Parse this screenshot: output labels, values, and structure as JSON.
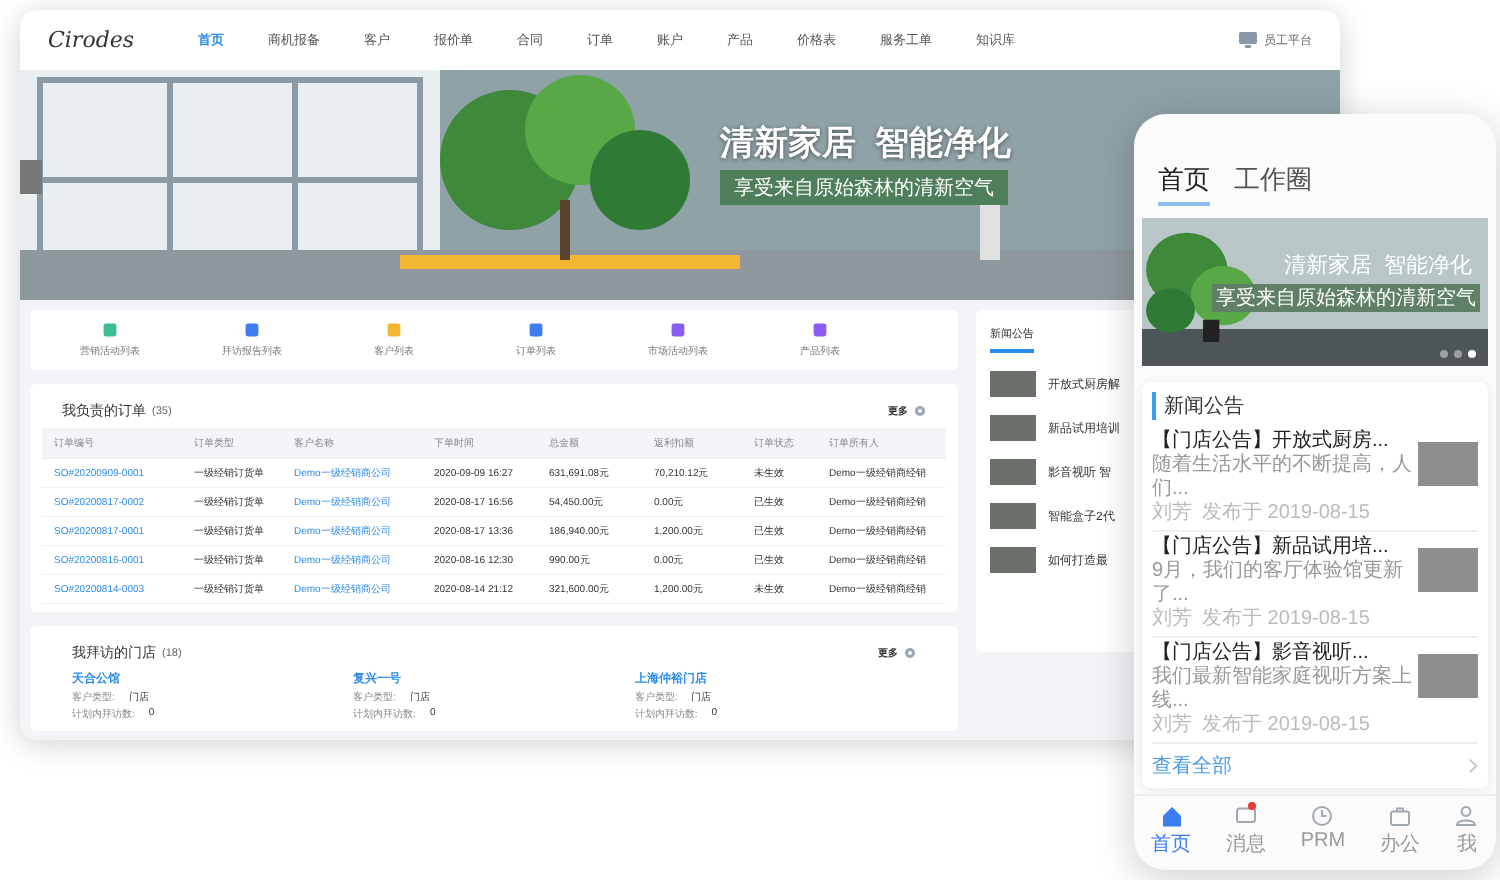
{
  "desktop": {
    "logo": "Cirodes",
    "nav": [
      {
        "label": "首页",
        "selected": true
      },
      {
        "label": "商机报备",
        "selected": false
      },
      {
        "label": "客户",
        "selected": false
      },
      {
        "label": "报价单",
        "selected": false
      },
      {
        "label": "合同",
        "selected": false
      },
      {
        "label": "订单",
        "selected": false
      },
      {
        "label": "账户",
        "selected": false
      },
      {
        "label": "产品",
        "selected": false
      },
      {
        "label": "价格表",
        "selected": false
      },
      {
        "label": "服务工单",
        "selected": false
      },
      {
        "label": "知识库",
        "selected": false
      }
    ],
    "portal": "员工平台",
    "banner": {
      "headline": "清新家居  智能净化",
      "tagline": "享受来自原始森林的清新空气"
    },
    "quick_links": [
      {
        "label": "营销活动列表",
        "color": "#3bbf8f"
      },
      {
        "label": "拜访报告列表",
        "color": "#3b7cf0"
      },
      {
        "label": "客户列表",
        "color": "#f2b632"
      },
      {
        "label": "订单列表",
        "color": "#3b7cf0"
      },
      {
        "label": "市场活动列表",
        "color": "#8a5cf0"
      },
      {
        "label": "产品列表",
        "color": "#8a5cf0"
      }
    ],
    "orders": {
      "title": "我负责的订单",
      "count": "(35)",
      "more": "更多",
      "columns": [
        "订单编号",
        "订单类型",
        "客户名称",
        "下单时间",
        "总金额",
        "返利扣额",
        "订单状态",
        "订单所有人"
      ],
      "rows": [
        [
          "SO#20200909-0001",
          "一级经销订货单",
          "Demo一级经销商公司",
          "2020-09-09 16:27",
          "631,691.08元",
          "70,210.12元",
          "未生效",
          "Demo一级经销商经销"
        ],
        [
          "SO#20200817-0002",
          "一级经销订货单",
          "Demo一级经销商公司",
          "2020-08-17 16:56",
          "54,450.00元",
          "0.00元",
          "已生效",
          "Demo一级经销商经销"
        ],
        [
          "SO#20200817-0001",
          "一级经销订货单",
          "Demo一级经销商公司",
          "2020-08-17 13:36",
          "186,940.00元",
          "1,200.00元",
          "已生效",
          "Demo一级经销商经销"
        ],
        [
          "SO#20200816-0001",
          "一级经销订货单",
          "Demo一级经销商公司",
          "2020-08-16 12:30",
          "990.00元",
          "0.00元",
          "已生效",
          "Demo一级经销商经销"
        ],
        [
          "SO#20200814-0003",
          "一级经销订货单",
          "Demo一级经销商公司",
          "2020-08-14 21:12",
          "321,600.00元",
          "1,200.00元",
          "未生效",
          "Demo一级经销商经销"
        ]
      ]
    },
    "stores": {
      "title": "我拜访的门店",
      "count": "(18)",
      "more": "更多",
      "items": [
        {
          "name": "天合公馆",
          "type_label": "客户类型:",
          "type": "门店",
          "visits_label": "计划内拜访数:",
          "visits": "0"
        },
        {
          "name": "复兴一号",
          "type_label": "客户类型:",
          "type": "门店",
          "visits_label": "计划内拜访数:",
          "visits": "0"
        },
        {
          "name": "上海仲裕门店",
          "type_label": "客户类型:",
          "type": "门店",
          "visits_label": "计划内拜访数:",
          "visits": "0"
        }
      ]
    },
    "news": {
      "title": "新闻公告",
      "items": [
        "开放式厨房解",
        "新品试用培训",
        "影音视听 智",
        "智能盒子2代",
        "如何打造最"
      ]
    }
  },
  "mobile": {
    "tabs": [
      {
        "label": "首页",
        "selected": true
      },
      {
        "label": "工作圈",
        "selected": false
      }
    ],
    "banner": {
      "headline": "清新家居  智能净化",
      "tagline": "享受来自原始森林的清新空气",
      "dots": [
        {
          "selected": false
        },
        {
          "selected": false
        },
        {
          "selected": true
        }
      ]
    },
    "news": {
      "title": "新闻公告",
      "view_all": "查看全部",
      "items": [
        {
          "title": "【门店公告】开放式厨房...",
          "excerpt": "随着生活水平的不断提高，人们...",
          "author": "刘芳",
          "date": "发布于 2019-08-15"
        },
        {
          "title": "【门店公告】新品试用培...",
          "excerpt": "9月，我们的客厅体验馆更新了...",
          "author": "刘芳",
          "date": "发布于 2019-08-15"
        },
        {
          "title": "【门店公告】影音视听...",
          "excerpt": "我们最新智能家庭视听方案上线...",
          "author": "刘芳",
          "date": "发布于 2019-08-15"
        }
      ]
    },
    "tabbar": [
      {
        "label": "首页",
        "selected": true,
        "badge": false
      },
      {
        "label": "消息",
        "selected": false,
        "badge": true
      },
      {
        "label": "PRM",
        "selected": false,
        "badge": false
      },
      {
        "label": "办公",
        "selected": false,
        "badge": false
      },
      {
        "label": "我",
        "selected": false,
        "badge": false
      }
    ]
  }
}
